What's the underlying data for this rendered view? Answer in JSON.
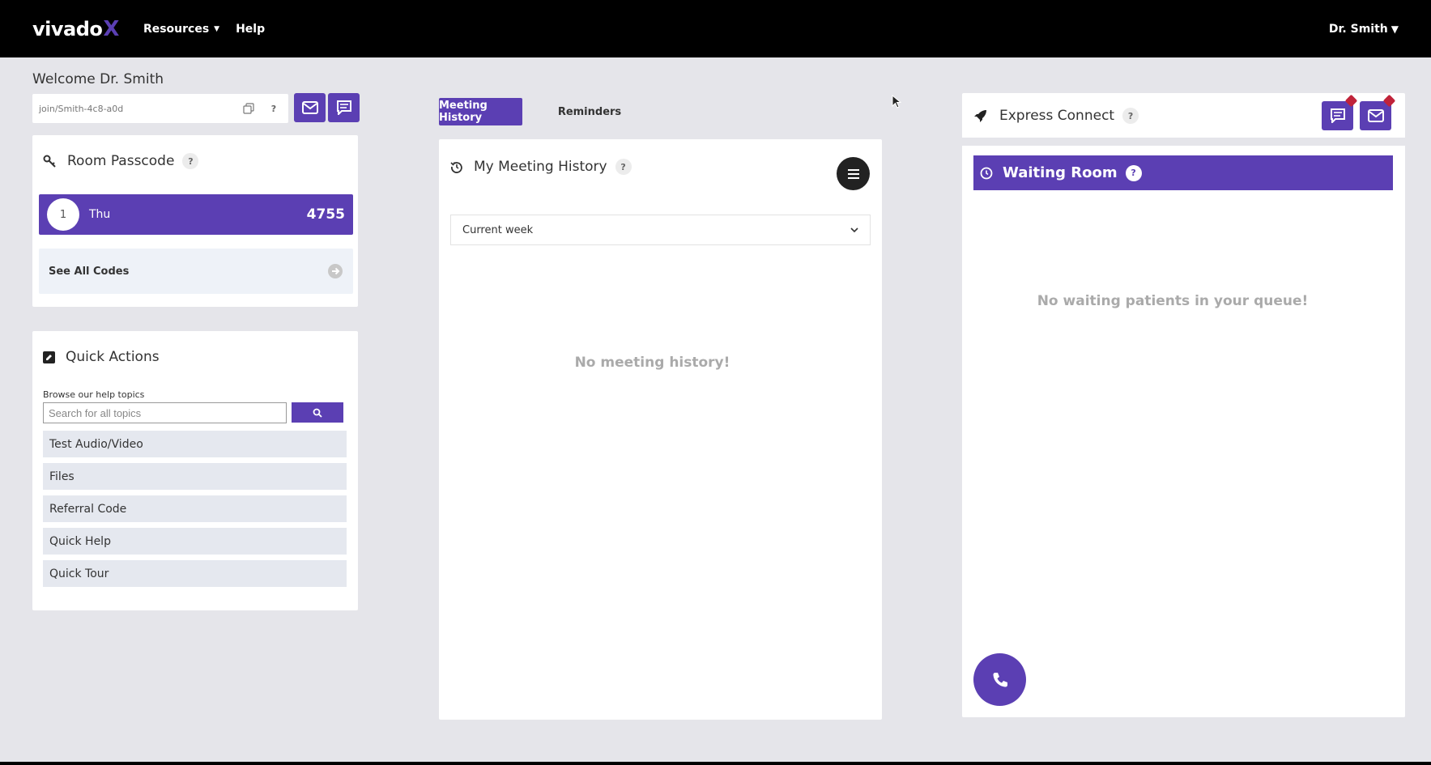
{
  "header": {
    "logo_text": "vivado",
    "logo_accent": "X",
    "nav": [
      {
        "label": "Resources",
        "has_dropdown": true
      },
      {
        "label": "Help",
        "has_dropdown": false
      }
    ],
    "user_menu_label": "Dr. Smith"
  },
  "left": {
    "welcome": "Welcome Dr. Smith",
    "join_link": "join/Smith-4c8-a0d",
    "room_passcode": {
      "title": "Room Passcode",
      "entry": {
        "number": "1",
        "day": "Thu",
        "code": "4755"
      },
      "see_all_label": "See All Codes"
    },
    "quick_actions": {
      "title": "Quick Actions",
      "browse_label": "Browse our help topics",
      "search_placeholder": "Search for all topics",
      "items": [
        "Test Audio/Video",
        "Files",
        "Referral Code",
        "Quick Help",
        "Quick Tour"
      ]
    }
  },
  "middle": {
    "tabs": [
      {
        "label": "Meeting History",
        "active": true
      },
      {
        "label": "Reminders",
        "active": false
      }
    ],
    "history_title": "My Meeting History",
    "filter_selected": "Current week",
    "empty_message": "No meeting history!"
  },
  "right": {
    "express_title": "Express Connect",
    "waiting_room_title": "Waiting Room",
    "empty_message": "No waiting patients in your queue!"
  },
  "colors": {
    "accent": "#5b3fb3",
    "background": "#e5e5ea",
    "topbar": "#000000",
    "badge": "#c0233a"
  }
}
